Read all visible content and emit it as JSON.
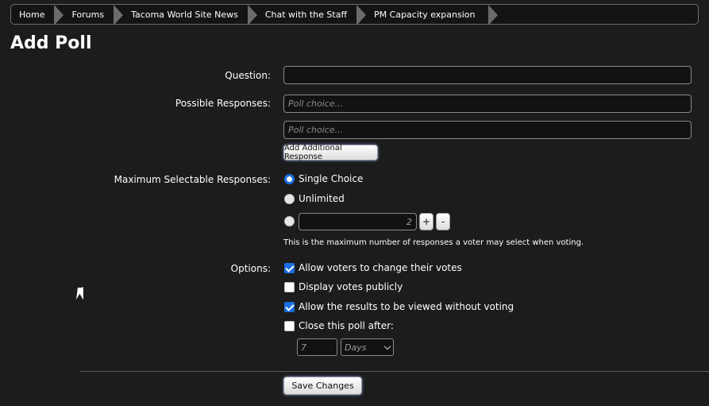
{
  "breadcrumb": [
    "Home",
    "Forums",
    "Tacoma World Site News",
    "Chat with the Staff",
    "PM Capacity expansion"
  ],
  "page_title": "Add Poll",
  "question": {
    "label": "Question:",
    "value": ""
  },
  "responses": {
    "label": "Possible Responses:",
    "placeholder": "Poll choice...",
    "add_button": "Add Additional Response"
  },
  "max_responses": {
    "label": "Maximum Selectable Responses:",
    "single": "Single Choice",
    "unlimited": "Unlimited",
    "count_value": "2",
    "plus": "+",
    "minus": "-",
    "hint": "This is the maximum number of responses a voter may select when voting.",
    "selected": "single"
  },
  "options": {
    "label": "Options:",
    "items": [
      {
        "label": "Allow voters to change their votes",
        "checked": true
      },
      {
        "label": "Display votes publicly",
        "checked": false
      },
      {
        "label": "Allow the results to be viewed without voting",
        "checked": true
      },
      {
        "label": "Close this poll after:",
        "checked": false
      }
    ],
    "close_after_value": "7",
    "close_after_unit": "Days"
  },
  "save_button": "Save Changes",
  "colors": {
    "background": "#1c1c1c",
    "accent": "#1a6fe0",
    "border": "#8a8a8a"
  }
}
